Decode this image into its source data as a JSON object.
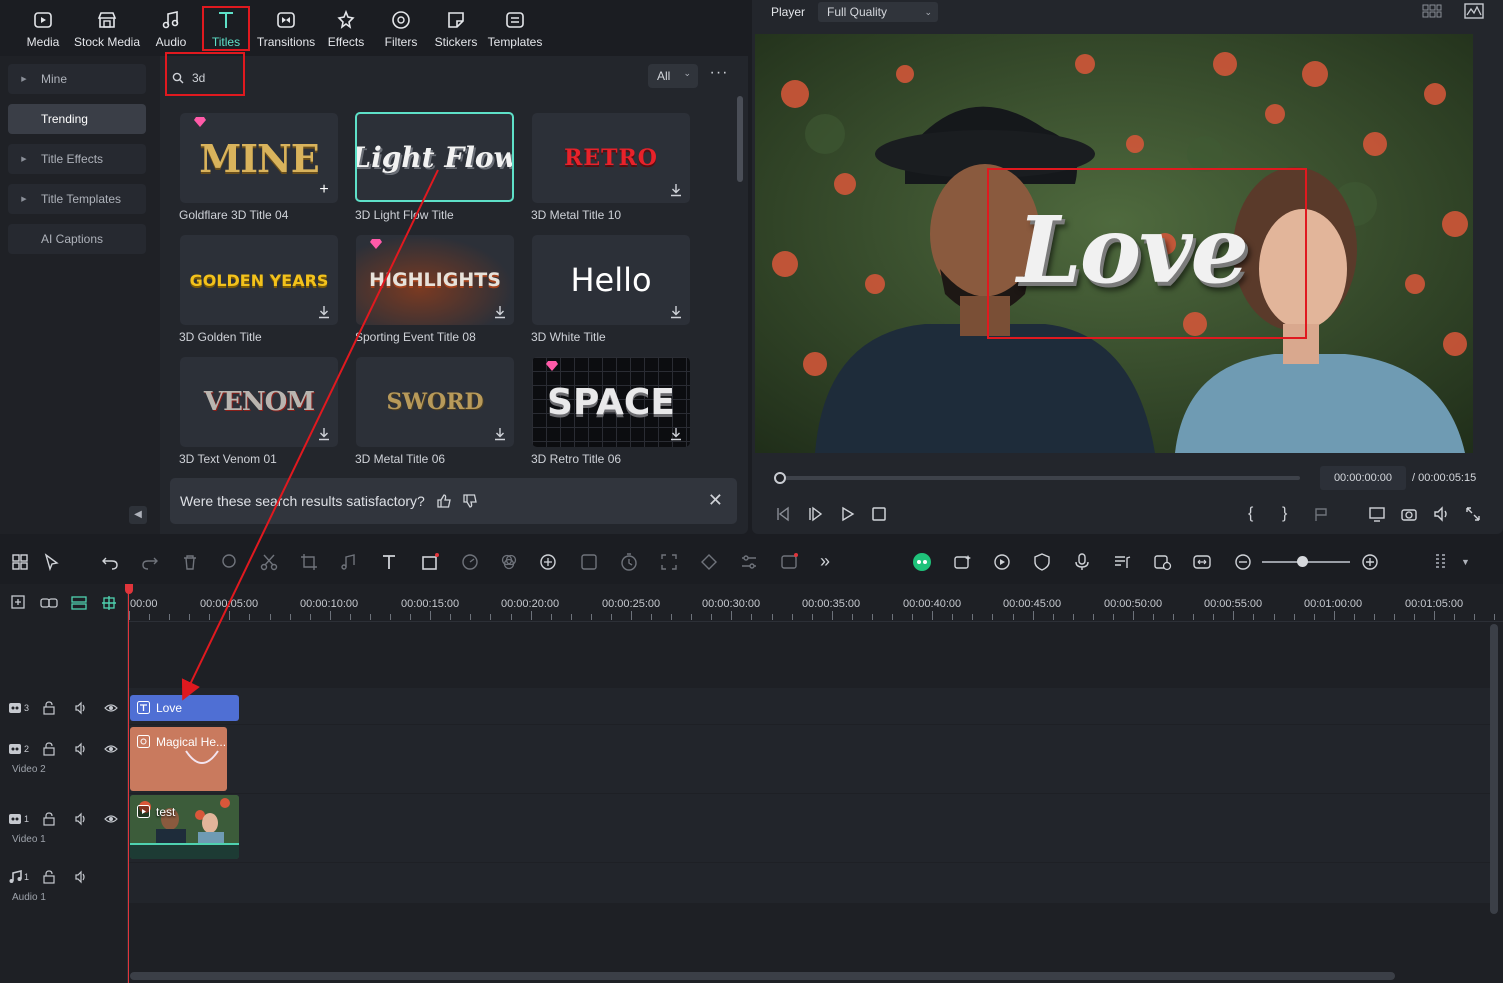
{
  "toolbar": {
    "tabs": [
      {
        "label": "Media",
        "icon": "media-icon"
      },
      {
        "label": "Stock Media",
        "icon": "stock-media-icon"
      },
      {
        "label": "Audio",
        "icon": "audio-icon"
      },
      {
        "label": "Titles",
        "icon": "titles-icon",
        "active": true
      },
      {
        "label": "Transitions",
        "icon": "transitions-icon"
      },
      {
        "label": "Effects",
        "icon": "effects-icon"
      },
      {
        "label": "Filters",
        "icon": "filters-icon"
      },
      {
        "label": "Stickers",
        "icon": "stickers-icon"
      },
      {
        "label": "Templates",
        "icon": "templates-icon"
      }
    ]
  },
  "sidebar": {
    "items": [
      {
        "label": "Mine"
      },
      {
        "label": "Trending"
      },
      {
        "label": "Title Effects"
      },
      {
        "label": "Title Templates"
      },
      {
        "label": "AI Captions"
      }
    ]
  },
  "search": {
    "value": "3d"
  },
  "filter": {
    "value": "All"
  },
  "titles": [
    {
      "name": "Goldflare 3D Title 04",
      "art": "MINE"
    },
    {
      "name": "3D Light Flow Title",
      "art": "Light Flow"
    },
    {
      "name": "3D Metal Title 10",
      "art": "RETRO"
    },
    {
      "name": "3D Golden Title",
      "art": "GOLDEN YEARS"
    },
    {
      "name": "Sporting Event Title 08",
      "art": "HIGHLIGHTS"
    },
    {
      "name": "3D White Title",
      "art": "Hello"
    },
    {
      "name": "3D Text Venom 01",
      "art": "VENOM"
    },
    {
      "name": "3D Metal Title 06",
      "art": "SWORD"
    },
    {
      "name": "3D Retro Title 06",
      "art": "SPACE"
    }
  ],
  "feedback": {
    "question": "Were these search results satisfactory?"
  },
  "player": {
    "label": "Player",
    "quality": "Full Quality",
    "overlay_text": "Love",
    "current_time": "00:00:00:00",
    "total_time": "/ 00:00:05:15"
  },
  "timeline": {
    "ruler": [
      "00:00",
      "00:00:05:00",
      "00:00:10:00",
      "00:00:15:00",
      "00:00:20:00",
      "00:00:25:00",
      "00:00:30:00",
      "00:00:35:00",
      "00:00:40:00",
      "00:00:45:00",
      "00:00:50:00",
      "00:00:55:00",
      "00:01:00:00",
      "00:01:05:00"
    ],
    "tracks": {
      "t3": {
        "num": "3"
      },
      "t2": {
        "num": "2",
        "name": "Video 2"
      },
      "t1": {
        "num": "1",
        "name": "Video 1"
      },
      "a1": {
        "num": "1",
        "name": "Audio 1"
      }
    },
    "clips": {
      "title": "Love",
      "effect": "Magical He...",
      "video": "test"
    }
  },
  "colors": {
    "accent": "#5ee0c8",
    "annotation": "#e0191f",
    "playhead": "#e0353b",
    "title_clip": "#4f6fd4",
    "effect_clip": "#c97a5e"
  }
}
